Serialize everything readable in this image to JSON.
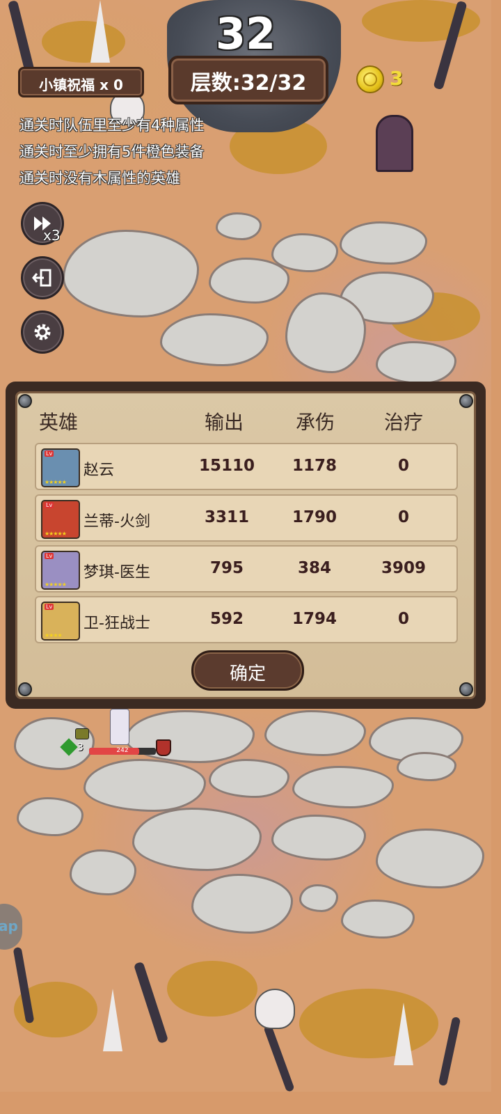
{
  "hud": {
    "current_level": "32",
    "floor_label": "层数:32/32",
    "blessing_label": "小镇祝福 x 0",
    "coins": "3"
  },
  "goals": [
    "通关时队伍里至少有4种属性",
    "通关时至少拥有5件橙色装备",
    "通关时没有木属性的英雄"
  ],
  "side_buttons": {
    "speed_label": "x3"
  },
  "stats_panel": {
    "headers": [
      "英雄",
      "输出",
      "承伤",
      "治疗"
    ],
    "rows": [
      {
        "name": "赵云",
        "output": "15110",
        "damage_taken": "1178",
        "heal": "0",
        "avatar_color": "#6a8fb0"
      },
      {
        "name": "兰蒂-火剑",
        "output": "3311",
        "damage_taken": "1790",
        "heal": "0",
        "avatar_color": "#c8452f"
      },
      {
        "name": "梦琪-医生",
        "output": "795",
        "damage_taken": "384",
        "heal": "3909",
        "avatar_color": "#9a8fc2"
      },
      {
        "name": "卫-狂战士",
        "output": "592",
        "damage_taken": "1794",
        "heal": "0",
        "avatar_color": "#d9b25a"
      }
    ],
    "confirm_label": "确定"
  },
  "unit": {
    "hp_text": "242",
    "hp_fraction": 0.75,
    "level": "3"
  },
  "side_tab_text": "ap",
  "colors": {
    "panel_frame": "#3b2a22",
    "panel_bg": "#d3bd98",
    "coin": "#f3dc3b",
    "ground": "#d99f72",
    "stone": "#d3d2ce"
  },
  "icons": [
    "fast-forward-icon",
    "exit-icon",
    "gear-icon",
    "coin-icon",
    "skull-icon"
  ]
}
